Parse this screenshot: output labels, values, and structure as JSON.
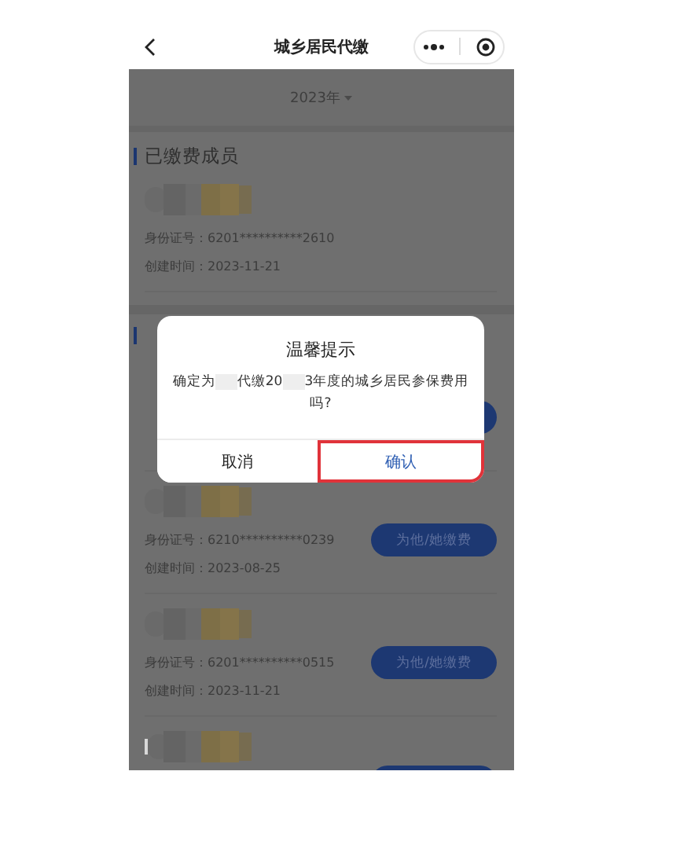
{
  "header": {
    "title": "城乡居民代缴"
  },
  "year_picker": {
    "label": "2023年"
  },
  "sections": [
    {
      "title": "已缴费成员",
      "members": [
        {
          "kind": "full",
          "id_label": "身份证号：",
          "id_value": "6201**********2610",
          "time_label": "创建时间：",
          "time_value": "2023-11-21"
        }
      ]
    },
    {
      "members": [
        {
          "kind": "covered",
          "has_button": true
        },
        {
          "kind": "full",
          "id_label": "身份证号：",
          "id_value": "6210**********0239",
          "time_label": "创建时间：",
          "time_value": "2023-08-25",
          "button": "为他/她缴费"
        },
        {
          "kind": "full",
          "id_label": "身份证号：",
          "id_value": "6201**********0515",
          "time_label": "创建时间：",
          "time_value": "2023-11-21",
          "button": "为他/她缴费"
        },
        {
          "kind": "name_only",
          "has_button": true
        }
      ]
    }
  ],
  "dialog": {
    "title": "温馨提示",
    "message": [
      {
        "kind": "text",
        "text": "确定为"
      },
      {
        "kind": "redacted"
      },
      {
        "kind": "text",
        "text": "代缴20"
      },
      {
        "kind": "redacted"
      },
      {
        "kind": "text",
        "text": "3年度的城乡居民参保费用吗?"
      }
    ],
    "buttons": [
      {
        "label": "取消",
        "highlighted": false
      },
      {
        "label": "确认",
        "highlighted": true
      }
    ]
  }
}
